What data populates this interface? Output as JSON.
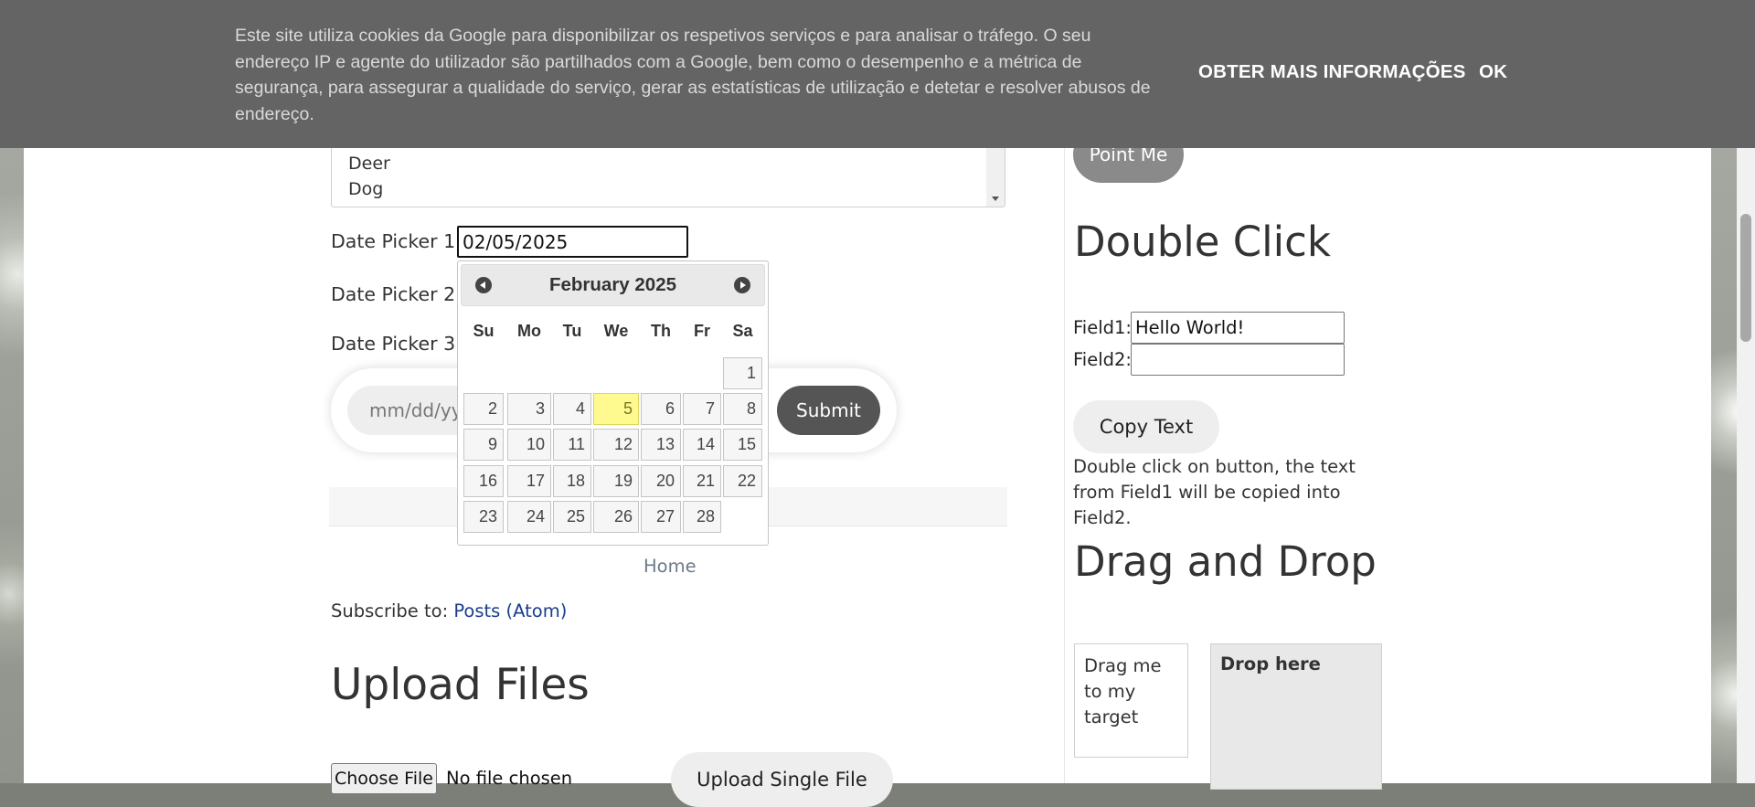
{
  "cookie": {
    "text": "Este site utiliza cookies da Google para disponibilizar os respetivos serviços e para analisar o tráfego. O seu endereço IP e agente do utilizador são partilhados com a Google, bem como o desempenho e a métrica de segurança, para assegurar a qualidade do serviço, gerar as estatísticas de utilização e detetar e resolver abusos de endereço.",
    "more_info": "OBTER MAIS INFORMAÇÕES",
    "ok": "OK"
  },
  "listbox": {
    "options": [
      "Deer",
      "Dog"
    ]
  },
  "datepickers": {
    "label1": "Date Picker 1:",
    "value1": "02/05/2025",
    "label2": "Date Picker 2:",
    "label3": "Date Picker 3:",
    "pill_placeholder": "mm/dd/yyyy",
    "submit": "Submit"
  },
  "calendar": {
    "title": "February 2025",
    "weekdays": [
      "Su",
      "Mo",
      "Tu",
      "We",
      "Th",
      "Fr",
      "Sa"
    ],
    "highlighted_day": "5",
    "weeks": [
      [
        "",
        "",
        "",
        "",
        "",
        "",
        "1"
      ],
      [
        "2",
        "3",
        "4",
        "5",
        "6",
        "7",
        "8"
      ],
      [
        "9",
        "10",
        "11",
        "12",
        "13",
        "14",
        "15"
      ],
      [
        "16",
        "17",
        "18",
        "19",
        "20",
        "21",
        "22"
      ],
      [
        "23",
        "24",
        "25",
        "26",
        "27",
        "28",
        ""
      ]
    ]
  },
  "footer": {
    "home": "Home",
    "subscribe_prefix": "Subscribe to:",
    "subscribe_link": "Posts (Atom)"
  },
  "upload": {
    "title": "Upload Files",
    "choose": "Choose File",
    "no_file": "No file chosen",
    "single": "Upload Single File"
  },
  "right": {
    "point_me": "Point Me",
    "double_click_title": "Double Click",
    "field1_label": "Field1:",
    "field1_value": "Hello World!",
    "field2_label": "Field2:",
    "field2_value": "",
    "copy_button": "Copy Text",
    "description": "Double click on button, the text from Field1 will be copied into Field2.",
    "drag_title": "Drag and Drop",
    "drag_box": "Drag me to my target",
    "drop_box": "Drop here"
  }
}
